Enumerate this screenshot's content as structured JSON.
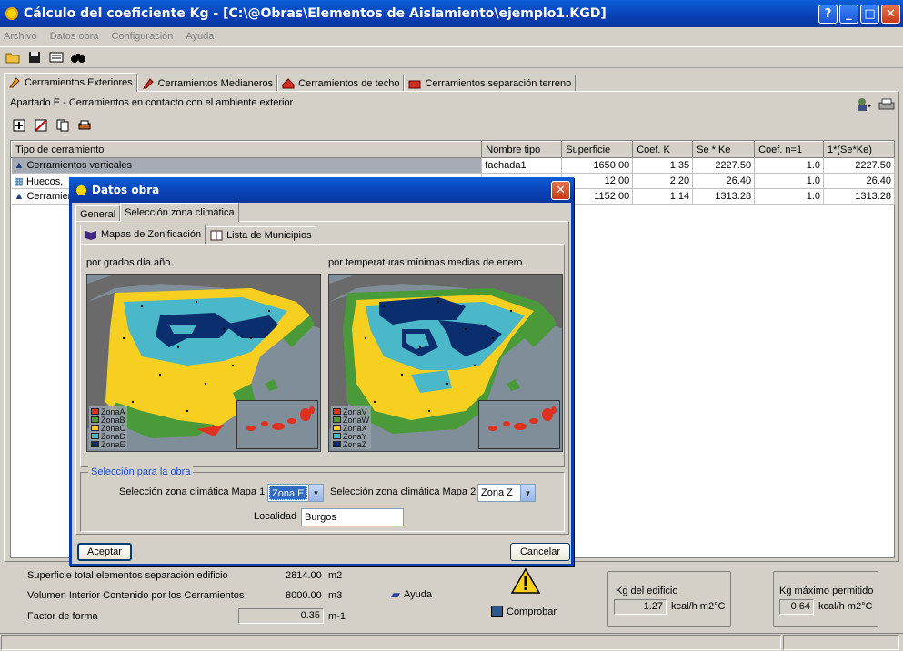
{
  "window": {
    "title": "Cálculo del coeficiente Kg - [C:\\@Obras\\Elementos de Aislamiento\\ejemplo1.KGD]",
    "help_btn": "?",
    "min_btn": "_",
    "max_btn": "□",
    "close_btn": "✕"
  },
  "menu": [
    "Archivo",
    "Datos obra",
    "Configuración",
    "Ayuda"
  ],
  "main_tabs": [
    "Cerramientos Exteriores",
    "Cerramientos Medianeros",
    "Cerramientos de techo",
    "Cerramientos separación terreno"
  ],
  "apartado": "Apartado E - Cerramientos en contacto con el ambiente exterior",
  "table": {
    "headers": [
      "Tipo de cerramiento",
      "Nombre tipo",
      "Superficie",
      "Coef. K",
      "Se * Ke",
      "Coef. n=1",
      "1*(Se*Ke)"
    ],
    "rows": [
      [
        "Cerramientos verticales",
        "fachada1",
        "1650.00",
        "1.35",
        "2227.50",
        "1.0",
        "2227.50"
      ],
      [
        "Huecos, ",
        "",
        "12.00",
        "2.20",
        "26.40",
        "1.0",
        "26.40"
      ],
      [
        "Cerramien",
        "",
        "1152.00",
        "1.14",
        "1313.28",
        "1.0",
        "1313.28"
      ]
    ]
  },
  "bottom": {
    "sup_label": "Superficie total elementos separación edificio",
    "sup_value": "2814.00",
    "sup_unit": "m2",
    "vol_label": "Volumen Interior Contenido por los Cerramientos",
    "vol_value": "8000.00",
    "vol_unit": "m3",
    "ff_label": "Factor de forma",
    "ff_value": "0.35",
    "ff_unit": "m-1",
    "ayuda": "Ayuda",
    "comprobar": "Comprobar",
    "kg_title": "Kg del edificio",
    "kg_value": "1.27",
    "kg_unit": "kcal/h m2°C",
    "kgmax_title": "Kg máximo permitido",
    "kgmax_value": "0.64",
    "kgmax_unit": "kcal/h m2°C"
  },
  "dialog": {
    "title": "Datos obra",
    "close": "✕",
    "tabs": [
      "General",
      "Selección zona climática"
    ],
    "subtabs": [
      "Mapas de Zonificación",
      "Lista de Municipios"
    ],
    "map1_label": "por grados día año.",
    "map2_label": "por temperaturas mínimas medias de enero.",
    "legend1": [
      "ZonaA",
      "ZonaB",
      "ZonaC",
      "ZonaD",
      "ZonaE"
    ],
    "legend2": [
      "ZonaV",
      "ZonaW",
      "ZonaX",
      "ZonaY",
      "ZonaZ"
    ],
    "group_title": "Selección para la obra",
    "sel1_label": "Selección zona climática Mapa 1",
    "sel1_value": "Zona E",
    "sel2_label": "Selección zona climática Mapa 2",
    "sel2_value": "Zona Z",
    "localidad_label": "Localidad",
    "localidad_value": "Burgos",
    "accept": "Aceptar",
    "cancel": "Cancelar"
  },
  "colors": {
    "zoneA": "#e03020",
    "zoneB": "#4a9a3a",
    "zoneC": "#f7cf20",
    "zoneD": "#4ab8c8",
    "zoneE": "#0b2f6e",
    "sea": "#7f8e98",
    "land": "#6a6a6a"
  }
}
